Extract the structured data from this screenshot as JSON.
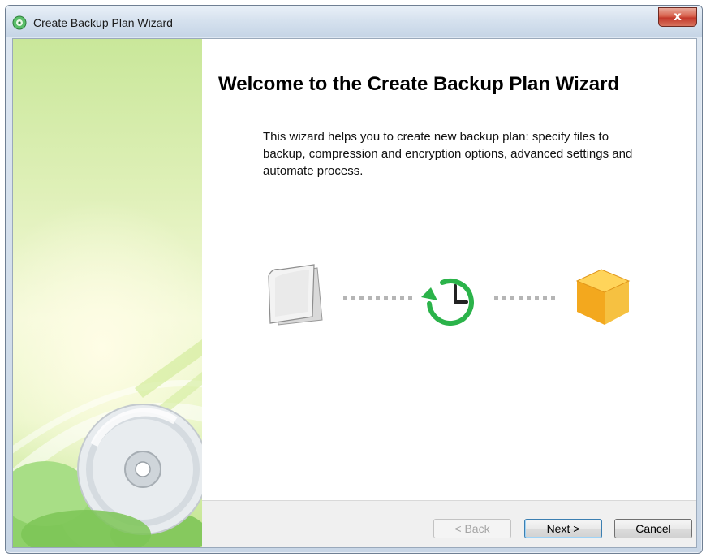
{
  "window": {
    "title": "Create Backup Plan Wizard",
    "close_label": "x"
  },
  "main": {
    "heading": "Welcome to the Create Backup Plan Wizard",
    "description": "This wizard helps you to create new backup plan: specify files to backup, compression and encryption options, advanced settings and automate process."
  },
  "flow": {
    "steps": [
      "files-icon",
      "schedule-clock-icon",
      "backup-box-icon"
    ]
  },
  "footer": {
    "back_label": "< Back",
    "next_label": "Next >",
    "cancel_label": "Cancel"
  },
  "colors": {
    "accent_green": "#2bb34a",
    "box_orange": "#f5a623",
    "banner_green": "#bfe38c"
  }
}
